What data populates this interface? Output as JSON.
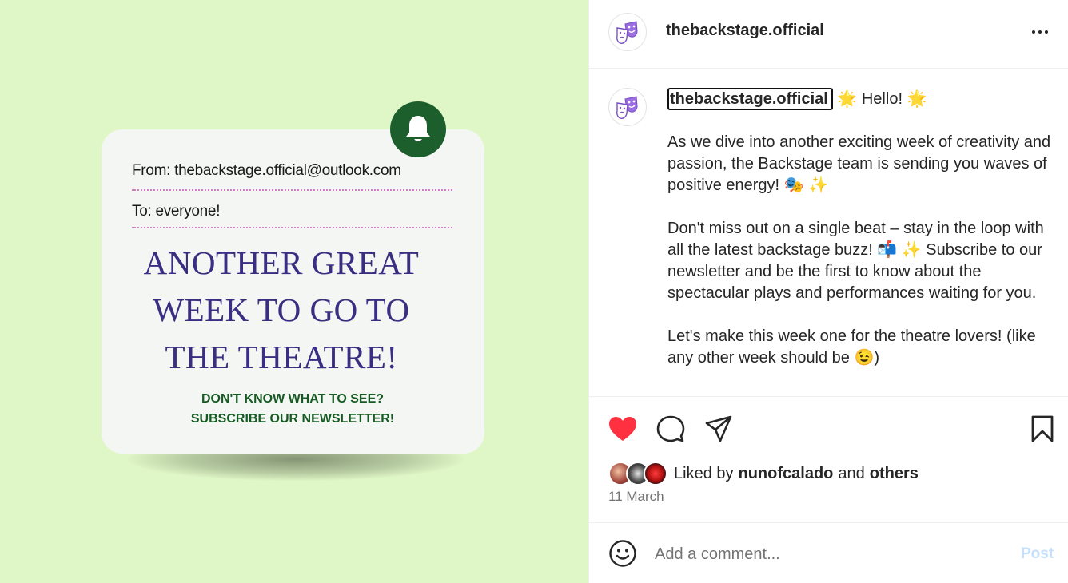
{
  "post_image": {
    "from_label": "From:",
    "from_value": "thebackstage.official@outlook.com",
    "to_label": "To:",
    "to_value": "everyone!",
    "headline_line1": "ANOTHER GREAT",
    "headline_line2": "WEEK TO GO TO",
    "headline_line3": "THE THEATRE!",
    "sub_line1": "DON'T KNOW WHAT TO SEE?",
    "sub_line2": "SUBSCRIBE OUR NEWSLETTER!",
    "colors": {
      "background": "#dff6c6",
      "card": "#f3f6f2",
      "bell_circle": "#1c5f2c",
      "headline": "#3a2d82",
      "subline": "#175a24",
      "divider": "#cf7fbf"
    }
  },
  "header": {
    "username": "thebackstage.official",
    "avatar_icon": "theatre-masks-icon",
    "more_icon": "more-options-icon"
  },
  "caption": {
    "username": "thebackstage.official",
    "line_intro": "🌟 Hello! 🌟",
    "para1": "As we dive into another exciting week of creativity and passion, the Backstage team is sending you waves of positive energy! 🎭 ✨",
    "para2": "Don't miss out on a single beat – stay in the loop with all the latest backstage buzz! 📬 ✨ Subscribe to our newsletter and be the first to know about the spectacular plays and performances waiting for you.",
    "para3": "Let's make this week one for the theatre lovers! (like any other week should be 😉)"
  },
  "actions": {
    "like_icon": "heart-filled-icon",
    "comment_icon": "comment-icon",
    "share_icon": "share-icon",
    "save_icon": "bookmark-icon",
    "like_color": "#ff3040"
  },
  "likes": {
    "prefix": "Liked by",
    "user": "nunofcalado",
    "and": "and",
    "others": "others"
  },
  "date": "11 March",
  "comment": {
    "placeholder": "Add a comment...",
    "post_label": "Post"
  }
}
